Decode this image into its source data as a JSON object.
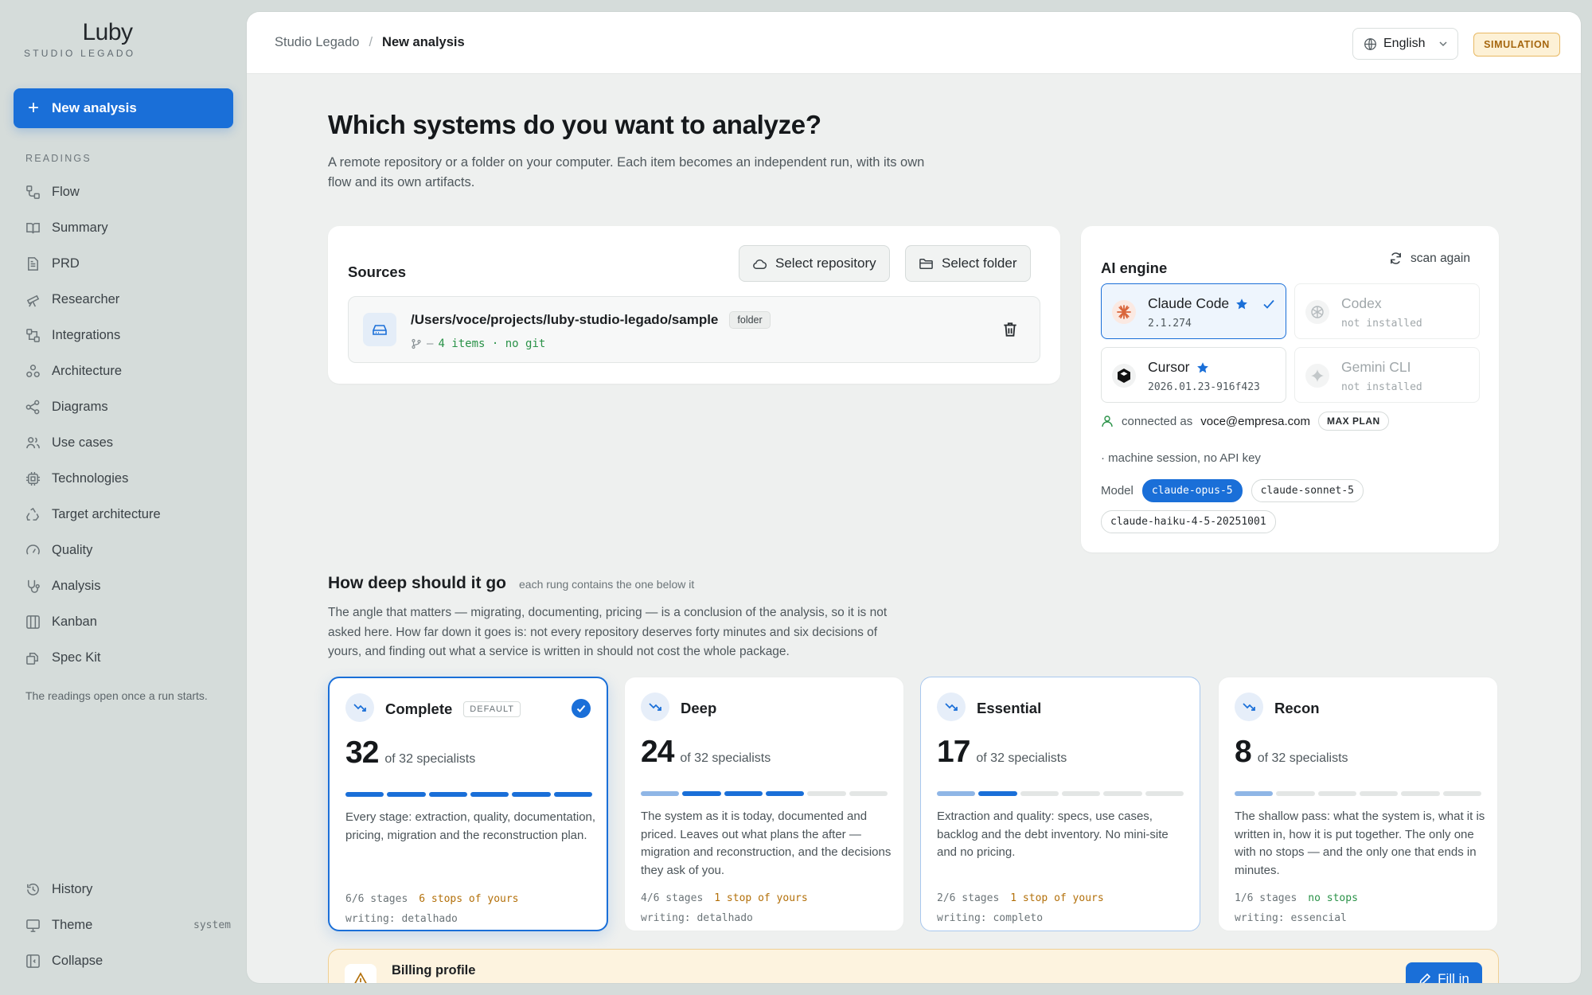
{
  "brand": {
    "logo": "Luby",
    "subtitle": "STUDIO LEGADO"
  },
  "sidebar": {
    "new_button": "New analysis",
    "section_label": "READINGS",
    "items": [
      {
        "label": "Flow",
        "icon": "flow-icon"
      },
      {
        "label": "Summary",
        "icon": "book-icon"
      },
      {
        "label": "PRD",
        "icon": "document-icon"
      },
      {
        "label": "Researcher",
        "icon": "telescope-icon"
      },
      {
        "label": "Integrations",
        "icon": "integrations-icon"
      },
      {
        "label": "Architecture",
        "icon": "architecture-icon"
      },
      {
        "label": "Diagrams",
        "icon": "share-icon"
      },
      {
        "label": "Use cases",
        "icon": "users-icon"
      },
      {
        "label": "Technologies",
        "icon": "chip-icon"
      },
      {
        "label": "Target architecture",
        "icon": "recycle-icon"
      },
      {
        "label": "Quality",
        "icon": "gauge-icon"
      },
      {
        "label": "Analysis",
        "icon": "stethoscope-icon"
      },
      {
        "label": "Kanban",
        "icon": "kanban-icon"
      },
      {
        "label": "Spec Kit",
        "icon": "spec-kit-icon"
      }
    ],
    "note": "The readings open once a run starts.",
    "bottom": {
      "history": "History",
      "theme": "Theme",
      "theme_value": "system",
      "collapse": "Collapse"
    }
  },
  "header": {
    "breadcrumb_root": "Studio Legado",
    "breadcrumb_sep": "/",
    "breadcrumb_current": "New analysis",
    "language": "English",
    "mode_badge": "SIMULATION"
  },
  "main": {
    "title": "Which systems do you want to analyze?",
    "lead": "A remote repository or a folder on your computer. Each item becomes an independent run, with its own flow and its own artifacts."
  },
  "sources": {
    "title": "Sources",
    "select_repo": "Select repository",
    "select_folder": "Select folder",
    "item": {
      "path": "/Users/voce/projects/luby-studio-legado/sample",
      "kind": "folder",
      "dash": "–",
      "meta": "4 items · no git"
    }
  },
  "engine": {
    "title": "AI engine",
    "scan": "scan again",
    "engines": [
      {
        "name": "Claude Code",
        "version": "2.1.274",
        "starred": true,
        "selected": true,
        "installed": true
      },
      {
        "name": "Codex",
        "version": "not installed",
        "starred": false,
        "selected": false,
        "installed": false
      },
      {
        "name": "Cursor",
        "version": "2026.01.23-916f423",
        "starred": true,
        "selected": false,
        "installed": true
      },
      {
        "name": "Gemini CLI",
        "version": "not installed",
        "starred": false,
        "selected": false,
        "installed": false
      }
    ],
    "connected_label": "connected as",
    "connected_email": "voce@empresa.com",
    "plan": "MAX PLAN",
    "session_note": "· machine session, no API key",
    "model_label": "Model",
    "models": [
      "claude-opus-5",
      "claude-sonnet-5",
      "claude-haiku-4-5-20251001"
    ],
    "selected_model": "claude-opus-5"
  },
  "depth": {
    "title": "How deep should it go",
    "hint": "each rung contains the one below it",
    "description": "The angle that matters — migrating, documenting, pricing — is a conclusion of the analysis, so it is not asked here. How far down it goes is: not every repository deserves forty minutes and six decisions of yours, and finding out what a service is written in should not cost the whole package.",
    "of_label": "of 32 specialists",
    "default_tag": "DEFAULT",
    "tiers": [
      {
        "name": "Complete",
        "count": "32",
        "segments_full": 6,
        "segments_partial": 0,
        "desc": "Every stage: extraction, quality, documentation, pricing, migration and the reconstruction plan.",
        "stages": "6/6 stages",
        "stops": "6 stops of yours",
        "writing": "writing: detalhado"
      },
      {
        "name": "Deep",
        "count": "24",
        "segments_full": 3,
        "segments_partial": 1,
        "desc": "The system as it is today, documented and priced. Leaves out what plans the after — migration and reconstruction, and the decisions they ask of you.",
        "stages": "4/6 stages",
        "stops": "1 stop of yours",
        "writing": "writing: detalhado"
      },
      {
        "name": "Essential",
        "count": "17",
        "segments_full": 1,
        "segments_partial": 1,
        "desc": "Extraction and quality: specs, use cases, backlog and the debt inventory. No mini-site and no pricing.",
        "stages": "2/6 stages",
        "stops": "1 stop of yours",
        "writing": "writing: completo"
      },
      {
        "name": "Recon",
        "count": "8",
        "segments_full": 0,
        "segments_partial": 1,
        "desc": "The shallow pass: what the system is, what it is written in, how it is put together. The only one with no stops — and the only one that ends in minutes.",
        "stages": "1/6 stages",
        "stops": "no stops",
        "writing": "writing: essencial"
      }
    ]
  },
  "billing": {
    "title": "Billing profile",
    "button": "Fill in"
  },
  "colors": {
    "accent": "#1a6fd8",
    "warning": "#b3700a",
    "success": "#2a9248"
  }
}
